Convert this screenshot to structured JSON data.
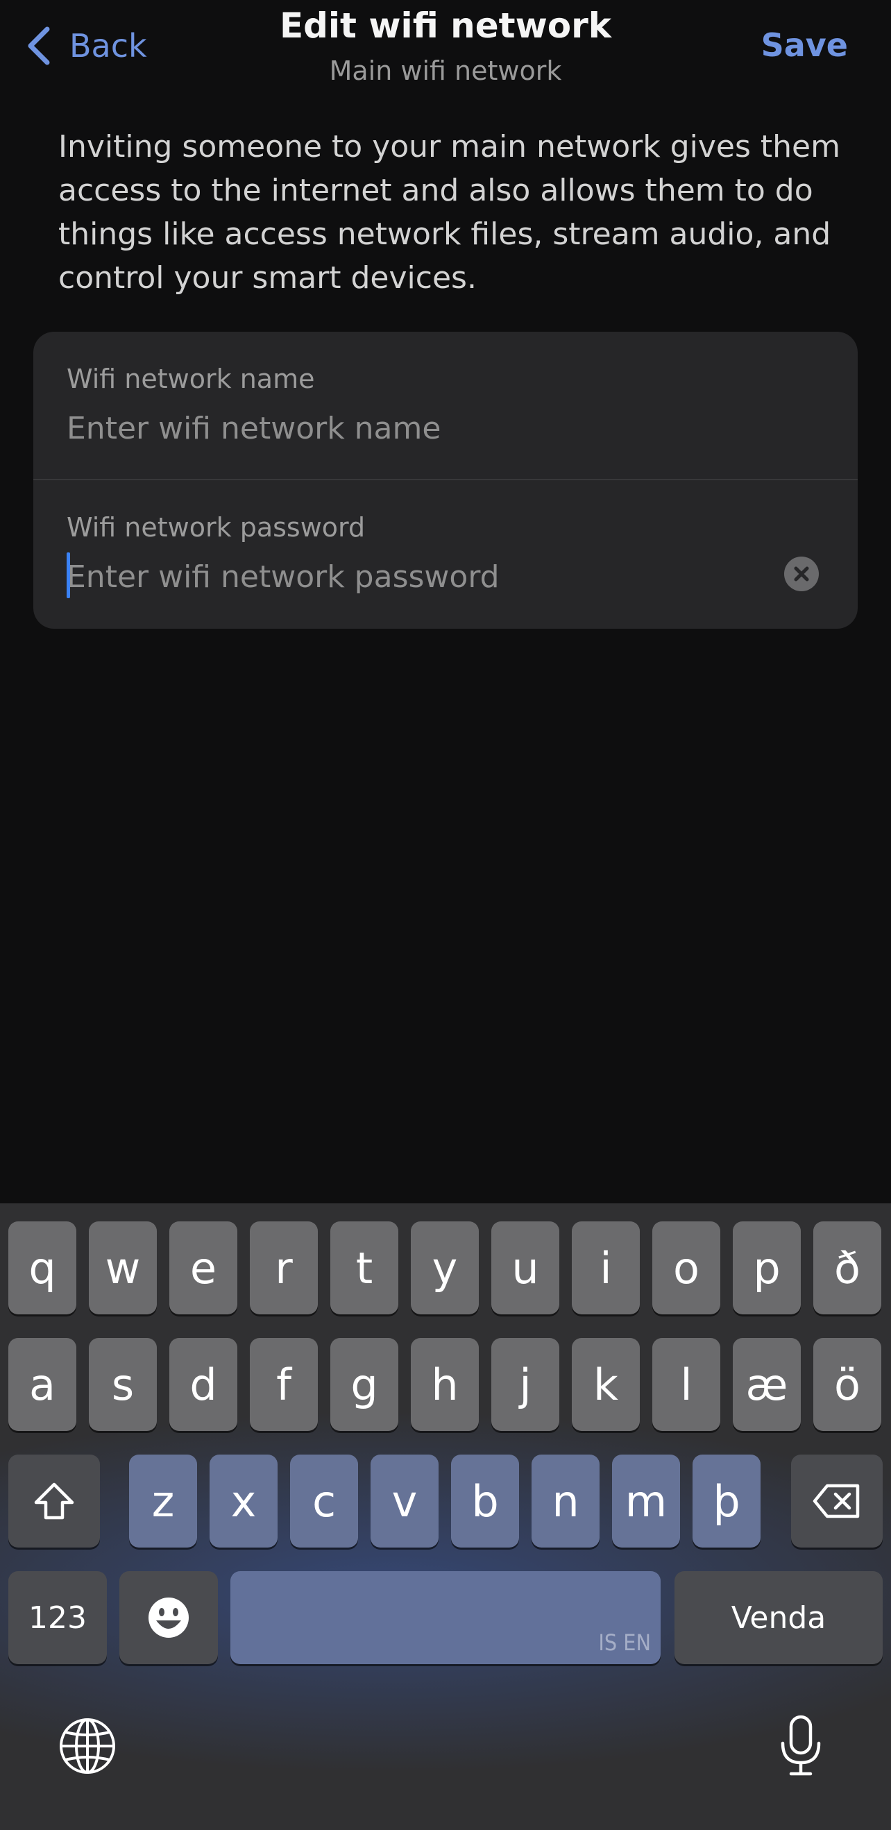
{
  "header": {
    "back_label": "Back",
    "title": "Edit wifi network",
    "subtitle": "Main wifi network",
    "save_label": "Save"
  },
  "description": "Inviting someone to your main network gives them access to the internet and also allows them to do things like access network files, stream audio, and control your smart devices.",
  "form": {
    "name_label": "Wifi network name",
    "name_placeholder": "Enter wifi network name",
    "name_value": "",
    "password_label": "Wifi network password",
    "password_placeholder": "Enter wifi network password",
    "password_value": ""
  },
  "keyboard": {
    "row1": [
      "q",
      "w",
      "e",
      "r",
      "t",
      "y",
      "u",
      "i",
      "o",
      "p",
      "ð"
    ],
    "row2": [
      "a",
      "s",
      "d",
      "f",
      "g",
      "h",
      "j",
      "k",
      "l",
      "æ",
      "ö"
    ],
    "row3": [
      "z",
      "x",
      "c",
      "v",
      "b",
      "n",
      "m",
      "þ"
    ],
    "numbers_label": "123",
    "language_indicator": "IS EN",
    "return_label": "Venda"
  },
  "colors": {
    "accent": "#6f93e0",
    "background": "#0e0e0f",
    "card": "#262628",
    "caret": "#3b82f6"
  },
  "icons": [
    "chevron-left-icon",
    "clear-icon",
    "shift-icon",
    "backspace-icon",
    "emoji-icon",
    "globe-icon",
    "microphone-icon"
  ]
}
